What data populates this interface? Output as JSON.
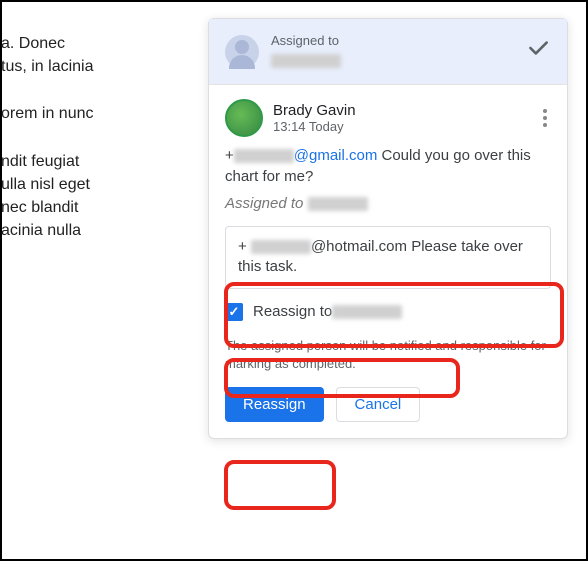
{
  "background": {
    "p1": "a. Donec\ntus, in lacinia",
    "p2": "orem in nunc",
    "p3": "ndit feugiat\nulla nisl eget\nnec blandit\nacinia nulla"
  },
  "header": {
    "label": "Assigned to",
    "assignee": "██████"
  },
  "comment": {
    "author": "Brady Gavin",
    "timestamp": "13:14 Today",
    "mention_prefix": "+",
    "mention_blur": "██████",
    "mention_suffix": "@gmail.com",
    "text": " Could you go over this chart for me?",
    "assigned_prefix": "Assigned to ",
    "assigned_blur": "██████"
  },
  "reply": {
    "mention_prefix": "+ ",
    "mention_blur": "██████",
    "mention_suffix": "@hotmail.com",
    "text": " Please take over this task."
  },
  "reassign": {
    "label": "Reassign to ",
    "target": "██████",
    "note": "The assigned person will be notified and responsible for marking as completed."
  },
  "buttons": {
    "primary": "Reassign",
    "cancel": "Cancel"
  }
}
